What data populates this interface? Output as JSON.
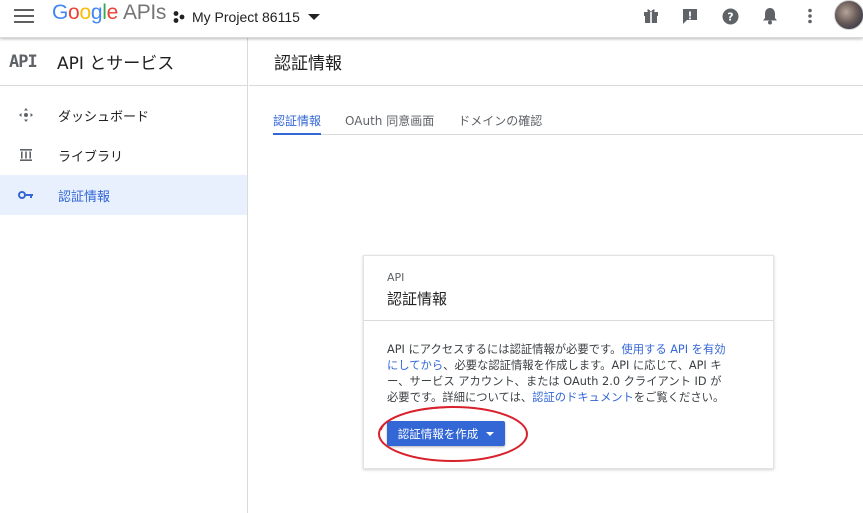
{
  "header": {
    "logo_parts": [
      "G",
      "o",
      "o",
      "g",
      "l",
      "e"
    ],
    "logo_suffix": "APIs",
    "project_name": "My Project 86115",
    "icons": [
      "hamburger-menu-icon",
      "gift-icon",
      "alert-icon",
      "help-icon",
      "notifications-icon",
      "more-vert-icon",
      "account-avatar"
    ]
  },
  "sidebar": {
    "api_mark": "API",
    "title": "API とサービス",
    "items": [
      {
        "label": "ダッシュボード",
        "icon": "dashboard-icon"
      },
      {
        "label": "ライブラリ",
        "icon": "library-icon"
      },
      {
        "label": "認証情報",
        "icon": "key-icon",
        "active": true
      }
    ]
  },
  "main": {
    "title": "認証情報",
    "tabs": [
      {
        "label": "認証情報",
        "active": true
      },
      {
        "label": "OAuth 同意画面"
      },
      {
        "label": "ドメインの確認"
      }
    ],
    "card": {
      "eyebrow": "API",
      "title": "認証情報",
      "body_1": "API にアクセスするには認証情報が必要です。",
      "link_1": "使用する API を有効にしてから",
      "body_2": "、必要な認証情報を作成します。API に応じて、API キー、サービス アカウント、または OAuth 2.0 クライアント ID が必要です。詳細については、",
      "link_2": "認証のドキュメント",
      "body_3": "をご覧ください。",
      "button_label": "認証情報を作成"
    }
  },
  "colors": {
    "accent": "#3367d6",
    "active_bg": "#e8f0fe",
    "annotation": "#d9212c"
  }
}
